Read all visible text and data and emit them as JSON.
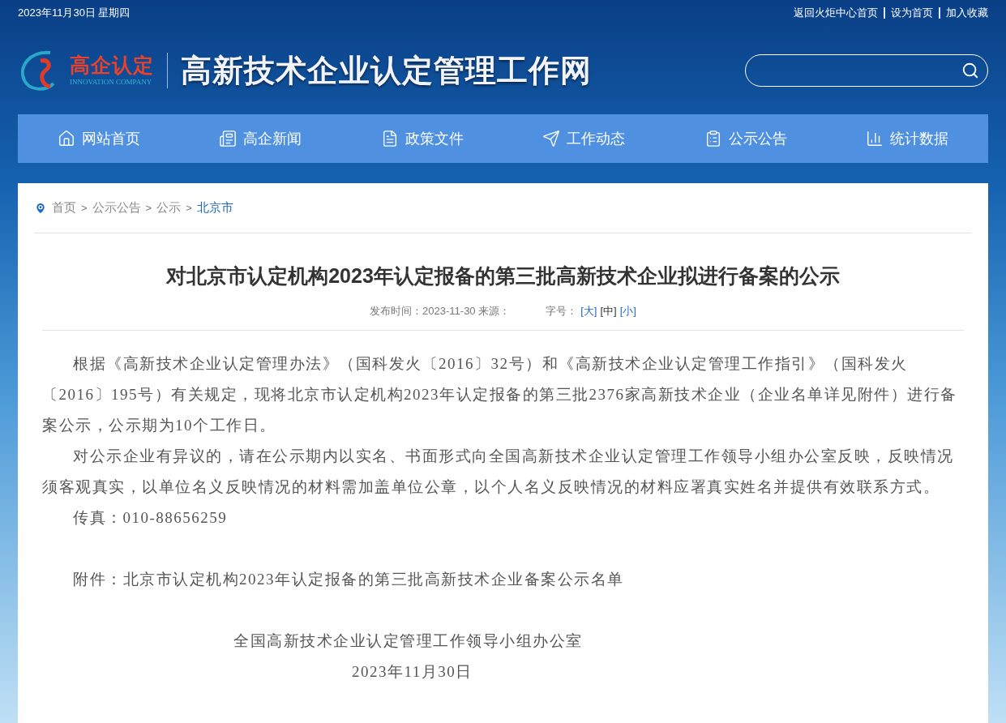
{
  "top_bar": {
    "date": "2023年11月30日 星期四",
    "links": [
      "返回火炬中心首页",
      "设为首页",
      "加入收藏"
    ]
  },
  "header": {
    "logo_text": "高企认定",
    "logo_subtext": "INNOVATION COMPANY",
    "site_title": "高新技术企业认定管理工作网"
  },
  "nav": {
    "items": [
      {
        "label": "网站首页",
        "selected": false
      },
      {
        "label": "高企新闻",
        "selected": false
      },
      {
        "label": "政策文件",
        "selected": false
      },
      {
        "label": "工作动态",
        "selected": false
      },
      {
        "label": "公示公告",
        "selected": false
      },
      {
        "label": "统计数据",
        "selected": false
      }
    ]
  },
  "breadcrumb": {
    "separator": ">",
    "items": [
      {
        "label": "首页",
        "current": false
      },
      {
        "label": "公示公告",
        "current": false
      },
      {
        "label": "公示",
        "current": false
      },
      {
        "label": "北京市",
        "current": true
      }
    ]
  },
  "article": {
    "title": "对北京市认定机构2023年认定报备的第三批高新技术企业拟进行备案的公示",
    "meta": "发布时间：2023-11-30 来源：",
    "font_size_label": "字号：",
    "font_sizes": [
      {
        "label": "[大]",
        "selected": false
      },
      {
        "label": "[中]",
        "selected": true
      },
      {
        "label": "[小]",
        "selected": false
      }
    ],
    "paragraphs": [
      "根据《高新技术企业认定管理办法》（国科发火〔2016〕32号）和《高新技术企业认定管理工作指引》（国科发火〔2016〕195号）有关规定，现将北京市认定机构2023年认定报备的第三批2376家高新技术企业（企业名单详见附件）进行备案公示，公示期为10个工作日。",
      "对公示企业有异议的，请在公示期内以实名、书面形式向全国高新技术企业认定管理工作领导小组办公室反映，反映情况须客观真实，以单位名义反映情况的材料需加盖单位公章，以个人名义反映情况的材料应署真实姓名并提供有效联系方式。",
      "传真：010-88656259"
    ],
    "attachment": "附件：北京市认定机构2023年认定报备的第三批高新技术企业备案公示名单",
    "signature": "全国高新技术企业认定管理工作领导小组办公室",
    "date": "2023年11月30日"
  }
}
